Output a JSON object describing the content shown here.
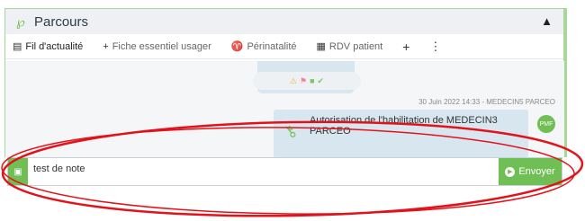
{
  "panel": {
    "title": "Parcours",
    "collapse_icon": "chevron-up-icon"
  },
  "tabs": [
    {
      "label": "Fil d'actualité",
      "icon": "news-icon",
      "active": true
    },
    {
      "label": "Fiche essentiel usager",
      "icon": "plus-icon"
    },
    {
      "label": "Périnatalité",
      "icon": "baby-icon"
    },
    {
      "label": "RDV patient",
      "icon": "calendar-icon"
    }
  ],
  "feed": {
    "status_icons": [
      "warning-icon",
      "flag-icon",
      "square-icon",
      "check-circle-icon"
    ],
    "meta": "30 Juin 2022 14:33 - MEDECIN5 PARCEO",
    "message": "Autorisation de l'habilitation de MEDECIN3 PARCEO",
    "avatar": "PMF"
  },
  "compose": {
    "value": "test de note",
    "send_label": "Envoyer"
  },
  "colors": {
    "accent": "#6fbf55",
    "bubble": "#d7e6ef",
    "annotation": "#e3121a"
  }
}
